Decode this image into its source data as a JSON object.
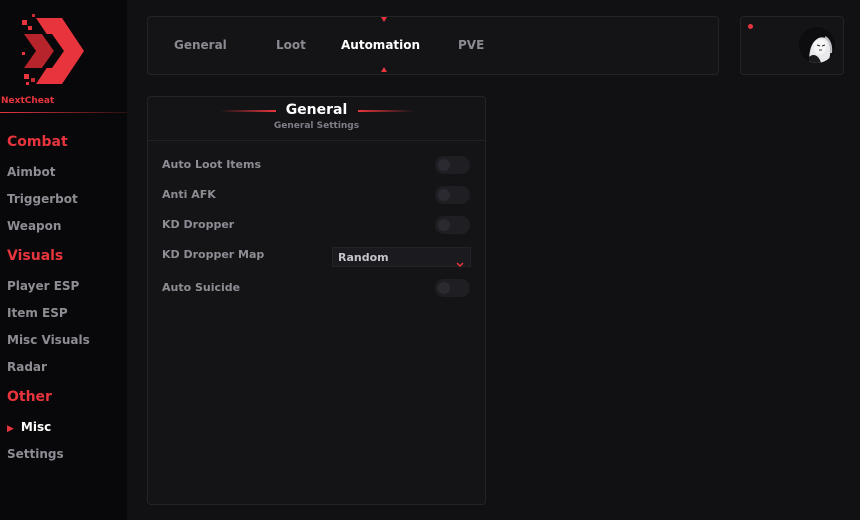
{
  "brand": {
    "name": "NextCheat"
  },
  "colors": {
    "accent": "#e8353d",
    "background": "#111114",
    "sidebar": "#08080a",
    "panel": "#141417"
  },
  "sidebar": {
    "sections": [
      {
        "label": "Combat",
        "items": [
          "Aimbot",
          "Triggerbot",
          "Weapon"
        ]
      },
      {
        "label": "Visuals",
        "items": [
          "Player ESP",
          "Item ESP",
          "Misc Visuals",
          "Radar"
        ]
      },
      {
        "label": "Other",
        "items": [
          "Misc",
          "Settings"
        ]
      }
    ],
    "active_item": "Misc",
    "active_marker_icon": "play-triangle-icon"
  },
  "tabs": {
    "items": [
      "General",
      "Loot",
      "Automation",
      "PVE"
    ],
    "active": "Automation"
  },
  "profile": {
    "status": "online-dot",
    "avatar_icon": "avatar-icon"
  },
  "panel": {
    "title": "General",
    "subtitle": "General Settings",
    "settings": [
      {
        "label": "Auto Loot Items",
        "type": "toggle",
        "on": false
      },
      {
        "label": "Anti AFK",
        "type": "toggle",
        "on": false
      },
      {
        "label": "KD Dropper",
        "type": "toggle",
        "on": false
      },
      {
        "label": "KD Dropper Map",
        "type": "select",
        "value": "Random",
        "icon": "chevron-down-icon"
      },
      {
        "label": "Auto Suicide",
        "type": "toggle",
        "on": false
      }
    ]
  }
}
